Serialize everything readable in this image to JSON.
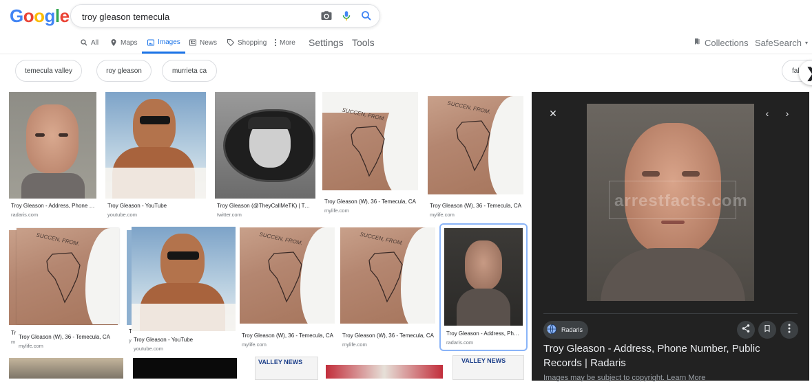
{
  "header": {
    "logo": [
      "G",
      "o",
      "o",
      "g",
      "l",
      "e"
    ],
    "search_value": "troy gleason temecula",
    "icons": [
      "camera-icon",
      "mic-icon",
      "search-icon"
    ]
  },
  "tabs": [
    {
      "label": "All",
      "icon": "search-icon"
    },
    {
      "label": "Maps",
      "icon": "map-pin-icon"
    },
    {
      "label": "Images",
      "icon": "image-icon",
      "active": true
    },
    {
      "label": "News",
      "icon": "news-icon"
    },
    {
      "label": "Shopping",
      "icon": "tag-icon"
    },
    {
      "label": "More",
      "icon": "more-vert-icon"
    }
  ],
  "settings_label": "Settings",
  "tools_label": "Tools",
  "collections_label": "Collections",
  "safesearch_label": "SafeSearch",
  "chips": [
    "temecula valley",
    "roy gleason",
    "murrieta ca",
    "fal"
  ],
  "results": [
    {
      "caption": "Troy Gleason - Address, Phone Number, Public Records | Radaris",
      "source": "radaris.com"
    },
    {
      "caption": "Troy Gleason - YouTube",
      "source": "youtube.com"
    },
    {
      "caption": "Troy Gleason (@TheyCallMeTK) | Twitter",
      "source": "twitter.com"
    },
    {
      "caption": "Troy Gleason (W), 36 - Temecula, CA",
      "source": "mylife.com"
    },
    {
      "caption": "Troy Gleason (W), 36 - Temecula, CA",
      "source": "mylife.com"
    },
    {
      "caption": "Troy Gleason (W), 36 - Temecula, CA",
      "source": "mylife.com"
    },
    {
      "caption": "Troy Gleason - YouTube",
      "source": "youtube.com"
    },
    {
      "caption": "Troy Gleason (W), 36 - Temecula, CA",
      "source": "mylife.com"
    },
    {
      "caption": "Troy Gleason (W), 36 - Temecula, CA",
      "source": "mylife.com"
    },
    {
      "caption": "Troy Gleason - Address, Phone Number, Public Records | Radaris",
      "source": "radaris.com"
    }
  ],
  "row2_behind": {
    "caption": "Tr",
    "source": "m"
  },
  "row2_behind2": {
    "caption": "T",
    "source": "y"
  },
  "tattoo_text": "SUCCEN, FROM.",
  "watermark": "arrestfacts.com",
  "preview": {
    "site": "Radaris",
    "title": "Troy Gleason - Address, Phone Number, Public Records | Radaris",
    "sub": "Images may be subject to copyright. Learn More"
  },
  "news_badge": "VALLEY NEWS",
  "colors": {
    "accent": "#1a73e8",
    "panel_bg": "#222222"
  }
}
